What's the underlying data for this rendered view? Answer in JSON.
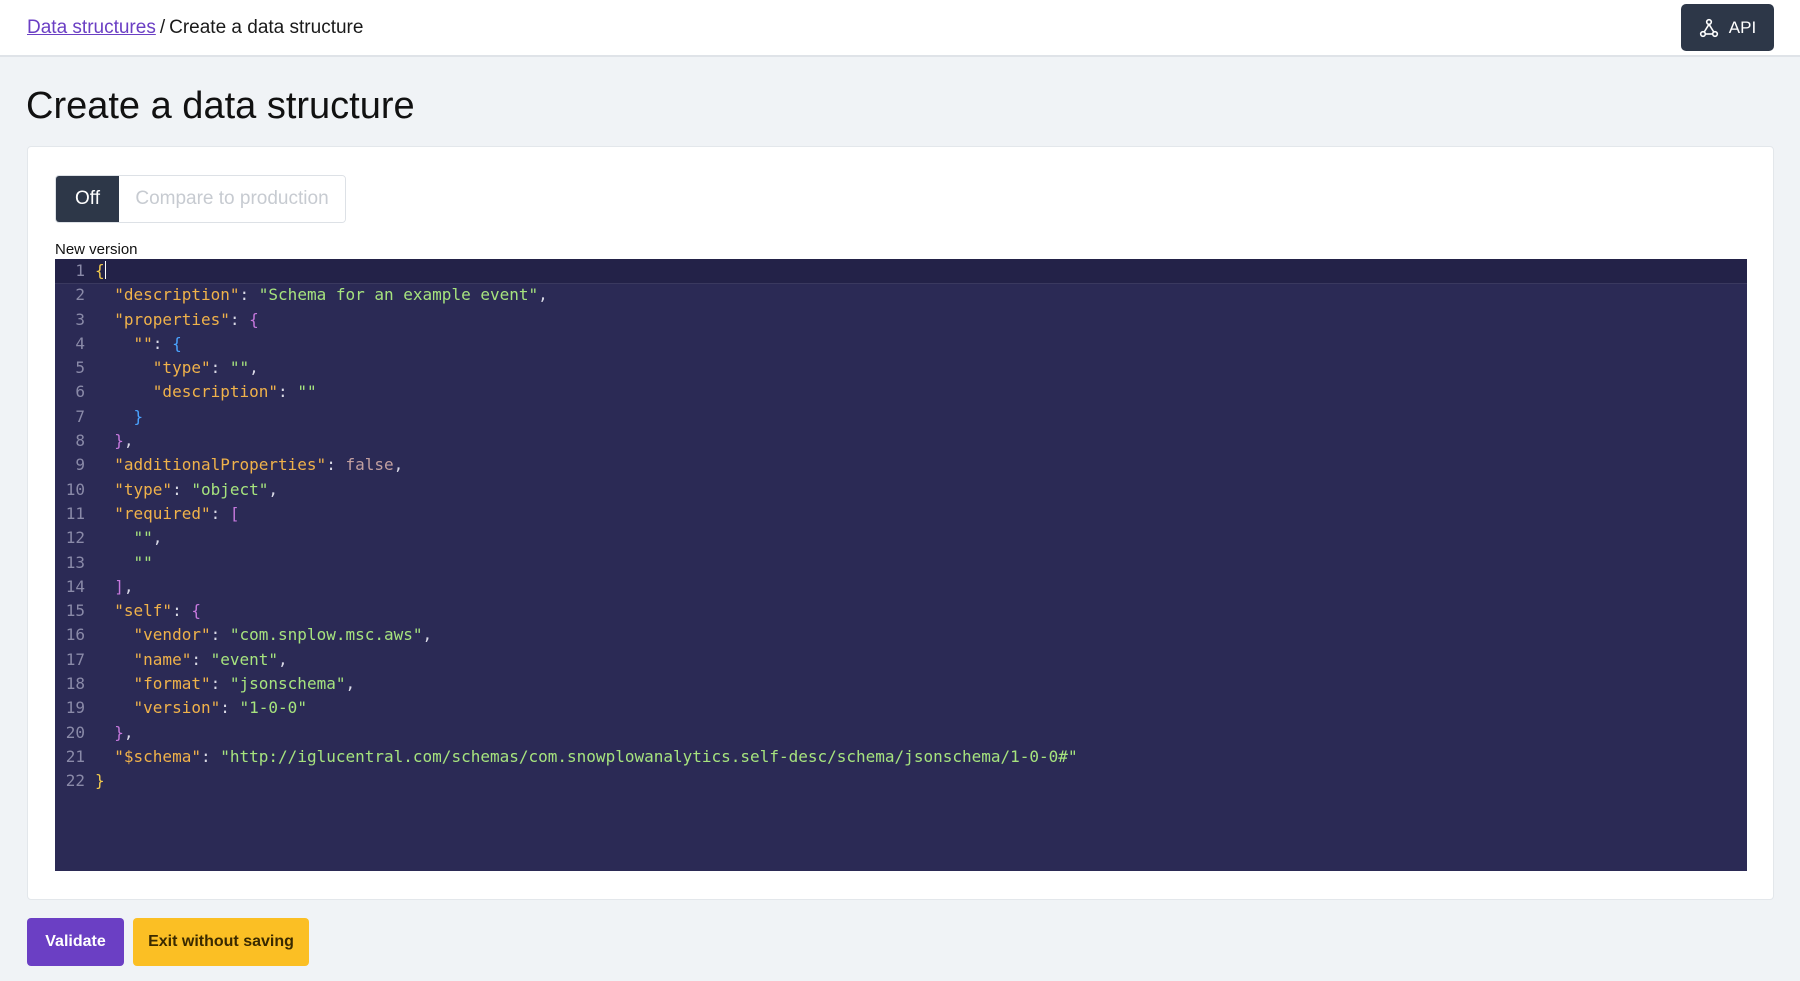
{
  "breadcrumb": {
    "parent_link": "Data structures",
    "separator": "/",
    "current": "Create a data structure"
  },
  "header": {
    "api_label": "API",
    "api_icon": "share-nodes-icon"
  },
  "page": {
    "title": "Create a data structure"
  },
  "compare_toggle": {
    "off_label": "Off",
    "compare_label": "Compare to production"
  },
  "editor": {
    "label": "New version",
    "lines": [
      "{",
      "  \"description\": \"Schema for an example event\",",
      "  \"properties\": {",
      "    \"\": {",
      "      \"type\": \"\",",
      "      \"description\": \"\"",
      "    }",
      "  },",
      "  \"additionalProperties\": false,",
      "  \"type\": \"object\",",
      "  \"required\": [",
      "    \"\",",
      "    \"\"",
      "  ],",
      "  \"self\": {",
      "    \"vendor\": \"com.snplow.msc.aws\",",
      "    \"name\": \"event\",",
      "    \"format\": \"jsonschema\",",
      "    \"version\": \"1-0-0\"",
      "  },",
      "  \"$schema\": \"http://iglucentral.com/schemas/com.snowplowanalytics.self-desc/schema/jsonschema/1-0-0#\"",
      "}"
    ]
  },
  "actions": {
    "validate_label": "Validate",
    "exit_label": "Exit without saving"
  },
  "colors": {
    "primary": "#6b3fc4",
    "warning": "#fbbf24",
    "dark": "#2d3748",
    "editor_bg": "#2b2a55"
  }
}
